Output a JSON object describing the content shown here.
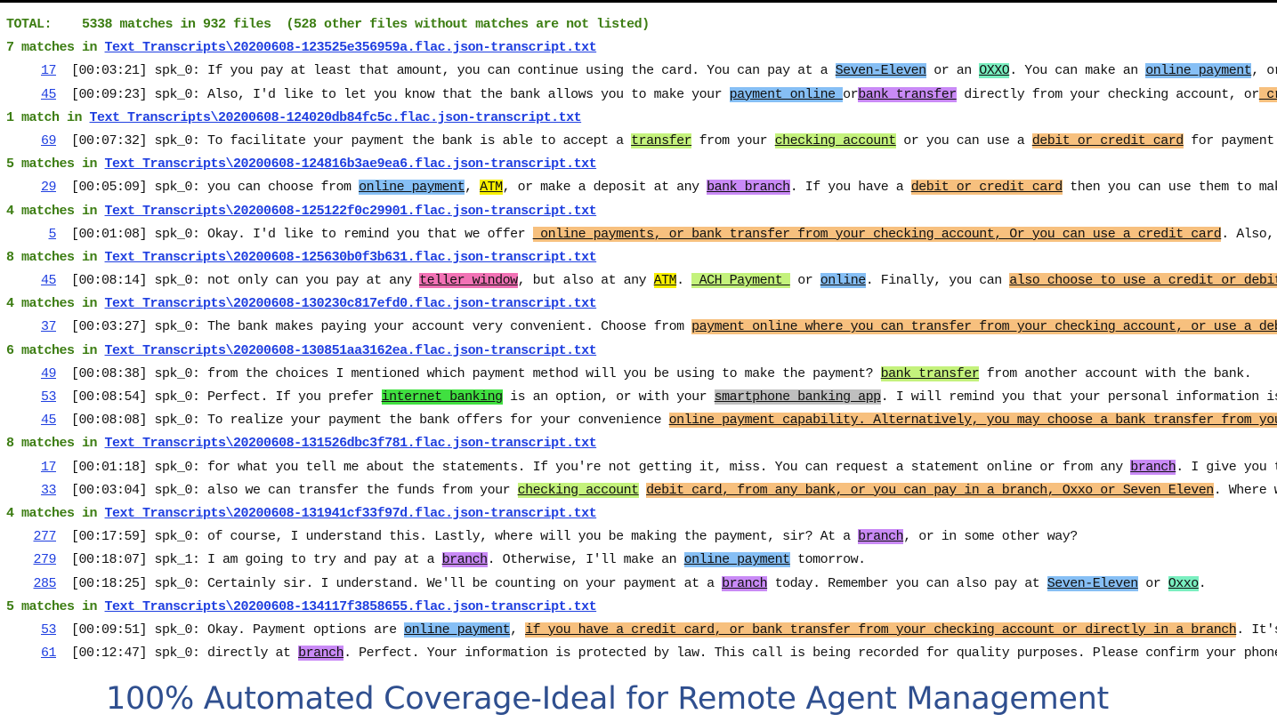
{
  "colors": {
    "blue": "#86bff5",
    "teal": "#7aefc0",
    "purple": "#c98af6",
    "orange": "#f7c07e",
    "green": "#c4f27c",
    "yellow": "#f8f000",
    "pink": "#f272b5",
    "gray": "#bfbfbf",
    "brightgreen": "#40e040"
  },
  "total": "TOTAL:    5338 matches in 932 files  (528 other files without matches are not listed)",
  "groups": [
    {
      "count": "7 matches in ",
      "file": "Text Transcripts\\20200608-123525e356959a.flac.json-transcript.txt",
      "lines": [
        {
          "num": "17",
          "ts": "[00:03:21] spk_0: ",
          "segs": [
            [
              "If you pay at least that amount, you can continue using the card. You can pay at a "
            ],
            [
              "Seven-Eleven",
              "blue"
            ],
            [
              " or an "
            ],
            [
              "OXXO",
              "teal"
            ],
            [
              ". You can make an "
            ],
            [
              "online payment",
              "blue"
            ],
            [
              ", or you can make"
            ]
          ]
        },
        {
          "num": "45",
          "ts": "[00:09:23] spk_0: ",
          "segs": [
            [
              "Also, I'd like to let you know that the bank allows you to make your "
            ],
            [
              "payment online ",
              "blue"
            ],
            [
              "or"
            ],
            [
              "bank transfer",
              "purple"
            ],
            [
              " directly from your checking account, or"
            ],
            [
              " credit or debit",
              "orange"
            ]
          ]
        }
      ]
    },
    {
      "count": "1 match in ",
      "file": "Text Transcripts\\20200608-124020db84fc5c.flac.json-transcript.txt",
      "lines": [
        {
          "num": "69",
          "ts": "[00:07:32] spk_0: ",
          "segs": [
            [
              "To facilitate your payment the bank is able to accept a "
            ],
            [
              "transfer",
              "green"
            ],
            [
              " from your "
            ],
            [
              "checking account",
              "green"
            ],
            [
              " or you can use a "
            ],
            [
              "debit or credit card",
              "orange"
            ],
            [
              " for payment. Also sir, it"
            ]
          ]
        }
      ]
    },
    {
      "count": "5 matches in ",
      "file": "Text Transcripts\\20200608-124816b3ae9ea6.flac.json-transcript.txt",
      "lines": [
        {
          "num": "29",
          "ts": "[00:05:09] spk_0: ",
          "segs": [
            [
              "you can choose from "
            ],
            [
              "online payment",
              "blue"
            ],
            [
              ", "
            ],
            [
              "ATM",
              "yellow"
            ],
            [
              ", or make a deposit at any "
            ],
            [
              "bank branch",
              "purple"
            ],
            [
              ". If you have a "
            ],
            [
              "debit or credit card",
              "orange"
            ],
            [
              " then you can use them to make a payment."
            ]
          ]
        }
      ]
    },
    {
      "count": "4 matches in ",
      "file": "Text Transcripts\\20200608-125122f0c29901.flac.json-transcript.txt",
      "lines": [
        {
          "num": "5",
          "ts": "[00:01:08] spk_0: ",
          "segs": [
            [
              "Okay. I'd like to remind you that we offer "
            ],
            [
              " online payments, or bank transfer from your checking account, Or you can use a credit card",
              "orange"
            ],
            [
              ". Also, you can pay a"
            ]
          ]
        }
      ]
    },
    {
      "count": "8 matches in ",
      "file": "Text Transcripts\\20200608-125630b0f3b631.flac.json-transcript.txt",
      "lines": [
        {
          "num": "45",
          "ts": "[00:08:14] spk_0: ",
          "segs": [
            [
              "not only can you pay at any "
            ],
            [
              "teller window",
              "pink"
            ],
            [
              ", but also at any "
            ],
            [
              "ATM",
              "yellow"
            ],
            [
              ". "
            ],
            [
              " ACH Payment ",
              "green"
            ],
            [
              " or "
            ],
            [
              "online",
              "blue"
            ],
            [
              ". Finally, you can "
            ],
            [
              "also choose to use a credit or debit card for pay",
              "orange"
            ]
          ]
        }
      ]
    },
    {
      "count": "4 matches in ",
      "file": "Text Transcripts\\20200608-130230c817efd0.flac.json-transcript.txt",
      "lines": [
        {
          "num": "37",
          "ts": "[00:03:27] spk_0: ",
          "segs": [
            [
              "The bank makes paying your account very convenient. Choose from "
            ],
            [
              "payment online where you can transfer from your checking account, or use a debit or credit ",
              "orange"
            ]
          ]
        }
      ]
    },
    {
      "count": "6 matches in ",
      "file": "Text Transcripts\\20200608-130851aa3162ea.flac.json-transcript.txt",
      "lines": [
        {
          "num": "49",
          "ts": "[00:08:38] spk_0: ",
          "segs": [
            [
              "from the choices I mentioned which payment method will you be using to make the payment? "
            ],
            [
              "bank transfer",
              "green"
            ],
            [
              " from another account with the bank."
            ]
          ]
        },
        {
          "num": "53",
          "ts": "[00:08:54] spk_0: ",
          "segs": [
            [
              "Perfect. If you prefer "
            ],
            [
              "internet banking",
              "brightgreen"
            ],
            [
              " is an option, or with your "
            ],
            [
              "smartphone banking app",
              "gray"
            ],
            [
              ". I will remind you that your personal information is protected by"
            ]
          ]
        },
        {
          "num": "45",
          "ts": "[00:08:08] spk_0: ",
          "segs": [
            [
              "To realize your payment the bank offers for your convenience "
            ],
            [
              "online payment capability. Alternatively, you may choose a bank transfer from your checking ac",
              "orange"
            ]
          ]
        }
      ]
    },
    {
      "count": "8 matches in ",
      "file": "Text Transcripts\\20200608-131526dbc3f781.flac.json-transcript.txt",
      "lines": [
        {
          "num": "17",
          "ts": "[00:01:18] spk_0: ",
          "segs": [
            [
              "for what you tell me about the statements. If you're not getting it, miss. You can request a statement online or from any "
            ],
            [
              "branch",
              "purple"
            ],
            [
              ". I give you the customer s"
            ]
          ]
        },
        {
          "num": "33",
          "ts": "[00:03:04] spk_0: ",
          "segs": [
            [
              "also we can transfer the funds from your "
            ],
            [
              "checking account",
              "green"
            ],
            [
              " "
            ],
            [
              "debit card, from any bank, or you can pay in a branch, Oxxo or Seven Eleven",
              "orange"
            ],
            [
              ". Where will you be ma"
            ]
          ]
        }
      ]
    },
    {
      "count": "4 matches in ",
      "file": "Text Transcripts\\20200608-131941cf33f97d.flac.json-transcript.txt",
      "lines": [
        {
          "num": "277",
          "ts": "[00:17:59] spk_0: ",
          "segs": [
            [
              "of course, I understand this. Lastly, where will you be making the payment, sir? At a "
            ],
            [
              "branch",
              "purple"
            ],
            [
              ", or in some other way?"
            ]
          ]
        },
        {
          "num": "279",
          "ts": "[00:18:07] spk_1: ",
          "segs": [
            [
              "I am going to try and pay at a "
            ],
            [
              "branch",
              "purple"
            ],
            [
              ". Otherwise, I'll make an "
            ],
            [
              "online payment",
              "blue"
            ],
            [
              " tomorrow."
            ]
          ]
        },
        {
          "num": "285",
          "ts": "[00:18:25] spk_0: ",
          "segs": [
            [
              "Certainly sir. I understand. We'll be counting on your payment at a "
            ],
            [
              "branch",
              "purple"
            ],
            [
              " today. Remember you can also pay at "
            ],
            [
              "Seven-Eleven",
              "blue"
            ],
            [
              " or "
            ],
            [
              "Oxxo",
              "teal"
            ],
            [
              "."
            ]
          ]
        }
      ]
    },
    {
      "count": "5 matches in ",
      "file": "Text Transcripts\\20200608-134117f3858655.flac.json-transcript.txt",
      "lines": [
        {
          "num": "53",
          "ts": "[00:09:51] spk_0: ",
          "segs": [
            [
              "Okay. Payment options are "
            ],
            [
              "online payment",
              "blue"
            ],
            [
              ", "
            ],
            [
              "if you have a credit card, or bank transfer from your checking account or directly in a branch",
              "orange"
            ],
            [
              ". It's important to"
            ]
          ]
        },
        {
          "num": "61",
          "ts": "[00:12:47] spk_0: ",
          "segs": [
            [
              "directly at "
            ],
            [
              "branch",
              "purple"
            ],
            [
              ". Perfect. Your information is protected by law. This call is being recorded for quality purposes. Please confirm your phone number for m"
            ]
          ]
        }
      ]
    }
  ],
  "caption": "100% Automated Coverage-Ideal for Remote Agent Management"
}
